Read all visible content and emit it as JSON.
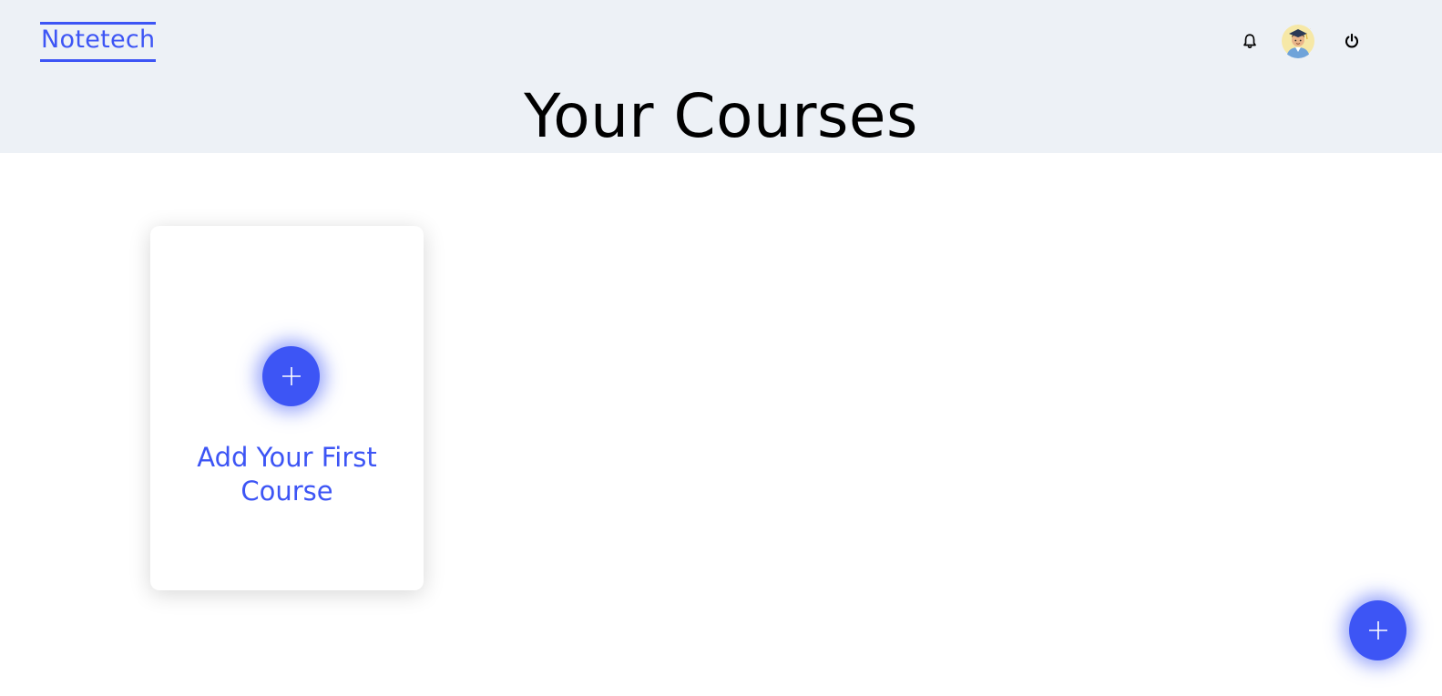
{
  "header": {
    "logo_text": "Notetech",
    "icons": {
      "notifications": "bell-icon",
      "profile": "avatar",
      "logout": "power-icon"
    }
  },
  "main": {
    "title": "Your Courses",
    "empty_card": {
      "label": "Add Your First Course",
      "icon": "plus-icon"
    }
  },
  "fab": {
    "icon": "plus-icon"
  },
  "colors": {
    "accent": "#3d55f5",
    "header_bg": "#edf1f6",
    "title_text": "#000000"
  }
}
